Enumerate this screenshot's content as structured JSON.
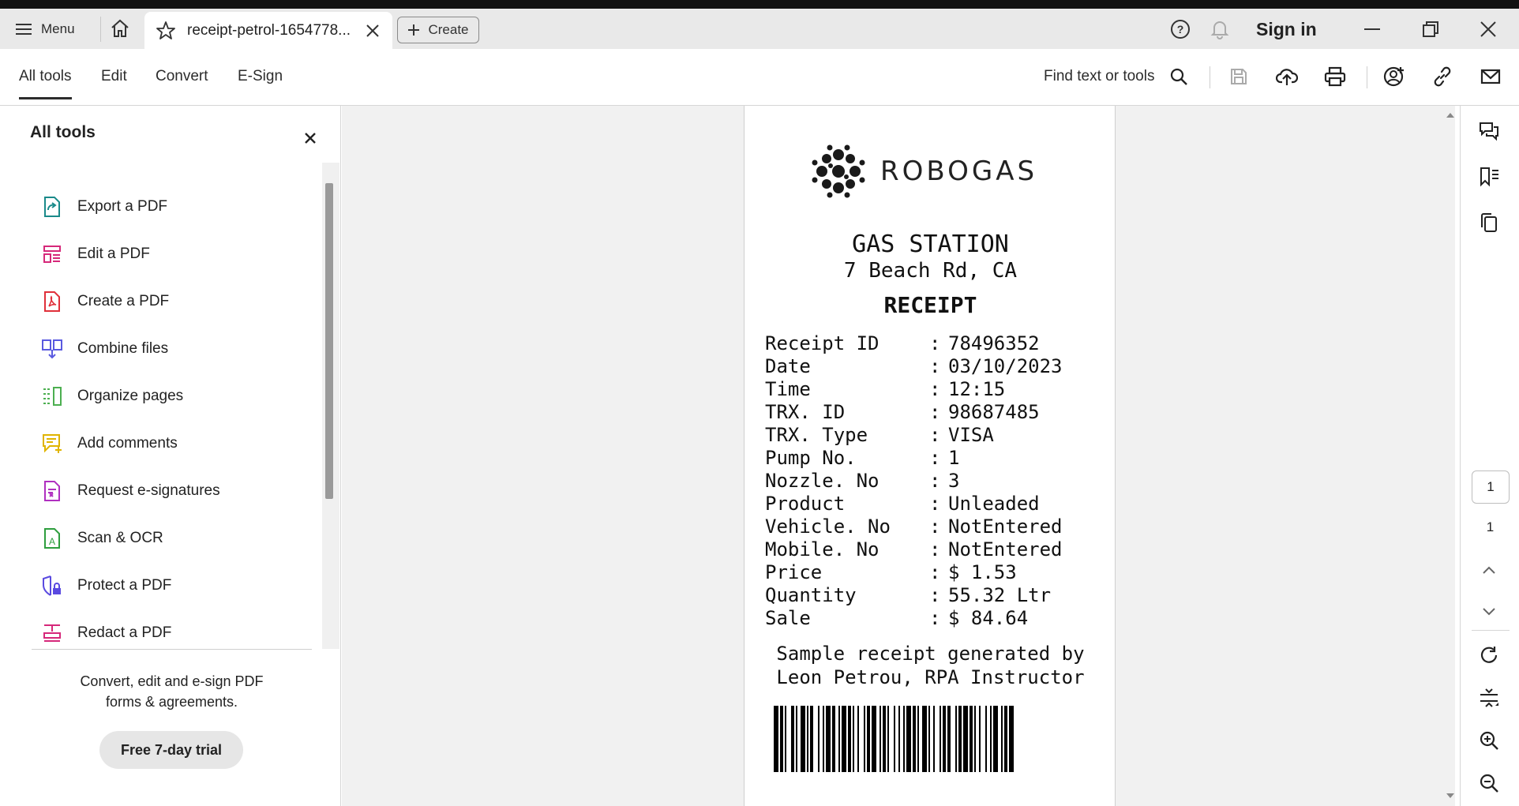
{
  "titlebar": {
    "menu_label": "Menu",
    "tab_title": "receipt-petrol-1654778...",
    "create_label": "Create",
    "signin_label": "Sign in"
  },
  "toolbar": {
    "tabs": [
      {
        "label": "All tools",
        "active": true
      },
      {
        "label": "Edit",
        "active": false
      },
      {
        "label": "Convert",
        "active": false
      },
      {
        "label": "E-Sign",
        "active": false
      }
    ],
    "find_label": "Find text or tools"
  },
  "left_panel": {
    "title": "All tools",
    "tools": [
      {
        "label": "Export a PDF",
        "icon": "export-pdf-icon",
        "color": "#1a8a8a"
      },
      {
        "label": "Edit a PDF",
        "icon": "edit-pdf-icon",
        "color": "#d6287a"
      },
      {
        "label": "Create a PDF",
        "icon": "create-pdf-icon",
        "color": "#e0303a"
      },
      {
        "label": "Combine files",
        "icon": "combine-files-icon",
        "color": "#5a5ae0"
      },
      {
        "label": "Organize pages",
        "icon": "organize-pages-icon",
        "color": "#4caf50"
      },
      {
        "label": "Add comments",
        "icon": "add-comments-icon",
        "color": "#e0b400"
      },
      {
        "label": "Request e-signatures",
        "icon": "request-esignatures-icon",
        "color": "#b030c0"
      },
      {
        "label": "Scan & OCR",
        "icon": "scan-ocr-icon",
        "color": "#2e9e3e"
      },
      {
        "label": "Protect a PDF",
        "icon": "protect-pdf-icon",
        "color": "#5a4ae0"
      },
      {
        "label": "Redact a PDF",
        "icon": "redact-pdf-icon",
        "color": "#d6287a"
      }
    ],
    "promo_line1": "Convert, edit and e-sign PDF",
    "promo_line2": "forms & agreements.",
    "trial_label": "Free 7-day trial"
  },
  "receipt": {
    "brand": "ROBOGAS",
    "station": "GAS STATION",
    "address": "7 Beach Rd, CA",
    "heading": "RECEIPT",
    "fields": [
      {
        "key": "Receipt ID",
        "value": "78496352"
      },
      {
        "key": "Date",
        "value": "03/10/2023"
      },
      {
        "key": "Time",
        "value": "12:15"
      },
      {
        "key": "TRX. ID",
        "value": "98687485"
      },
      {
        "key": "TRX. Type",
        "value": "VISA"
      },
      {
        "key": "Pump No.",
        "value": "1"
      },
      {
        "key": "Nozzle. No",
        "value": "3"
      },
      {
        "key": "Product",
        "value": "Unleaded"
      },
      {
        "key": "Vehicle. No",
        "value": "NotEntered"
      },
      {
        "key": "Mobile. No",
        "value": "NotEntered"
      },
      {
        "key": "Price",
        "value": "$ 1.53"
      },
      {
        "key": "Quantity",
        "value": "55.32 Ltr"
      },
      {
        "key": "Sale",
        "value": "$ 84.64"
      }
    ],
    "footer_line1": "Sample receipt generated by",
    "footer_line2": "Leon Petrou, RPA Instructor"
  },
  "navigation": {
    "current_page": "1",
    "total_pages": "1"
  }
}
